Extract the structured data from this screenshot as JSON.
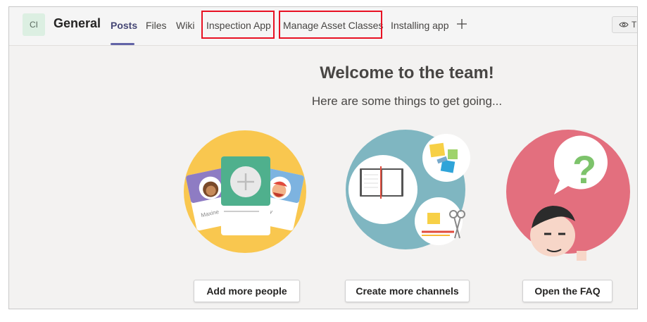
{
  "header": {
    "avatar_initials": "CI",
    "title": "General",
    "tabs": [
      {
        "label": "Posts",
        "active": true
      },
      {
        "label": "Files"
      },
      {
        "label": "Wiki"
      },
      {
        "label": "Inspection App",
        "highlighted": true
      },
      {
        "label": "Manage Asset Classes",
        "highlighted": true
      },
      {
        "label": "Installing app"
      }
    ],
    "add_tab_icon": "plus-icon",
    "team_button_icon": "eye-icon",
    "team_button_label": "T"
  },
  "main": {
    "welcome": "Welcome to the team!",
    "subtitle": "Here are some things to get going...",
    "cards": [
      {
        "button": "Add more people",
        "names": [
          "Maxine",
          "ky"
        ]
      },
      {
        "button": "Create more channels"
      },
      {
        "button": "Open the FAQ"
      }
    ]
  },
  "colors": {
    "accent": "#6264a7",
    "highlight": "#e81123",
    "yellow": "#f9c74f",
    "teal": "#7fb6c1",
    "pink": "#e36f7e"
  }
}
